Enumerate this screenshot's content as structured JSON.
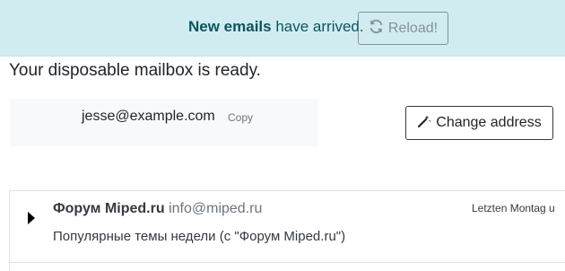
{
  "banner": {
    "strong_text": "New emails",
    "text": " have arrived.",
    "reload_label": "Reload!",
    "reload_icon": "refresh-icon"
  },
  "mailbox": {
    "ready_text": "Your disposable mailbox is ready.",
    "address": "jesse@example.com",
    "copy_label": "Copy",
    "change_label": "Change address",
    "change_icon": "magic-wand-icon"
  },
  "emails": [
    {
      "sender_name": "Форум Miped.ru",
      "sender_email": "info@miped.ru",
      "date": "Letzten Montag u",
      "subject": "Популярные темы недели (с \"Форум Miped.ru\")"
    }
  ],
  "colors": {
    "banner_bg": "#d1ecf1",
    "banner_text": "#0c5460",
    "muted": "#6c757d"
  }
}
